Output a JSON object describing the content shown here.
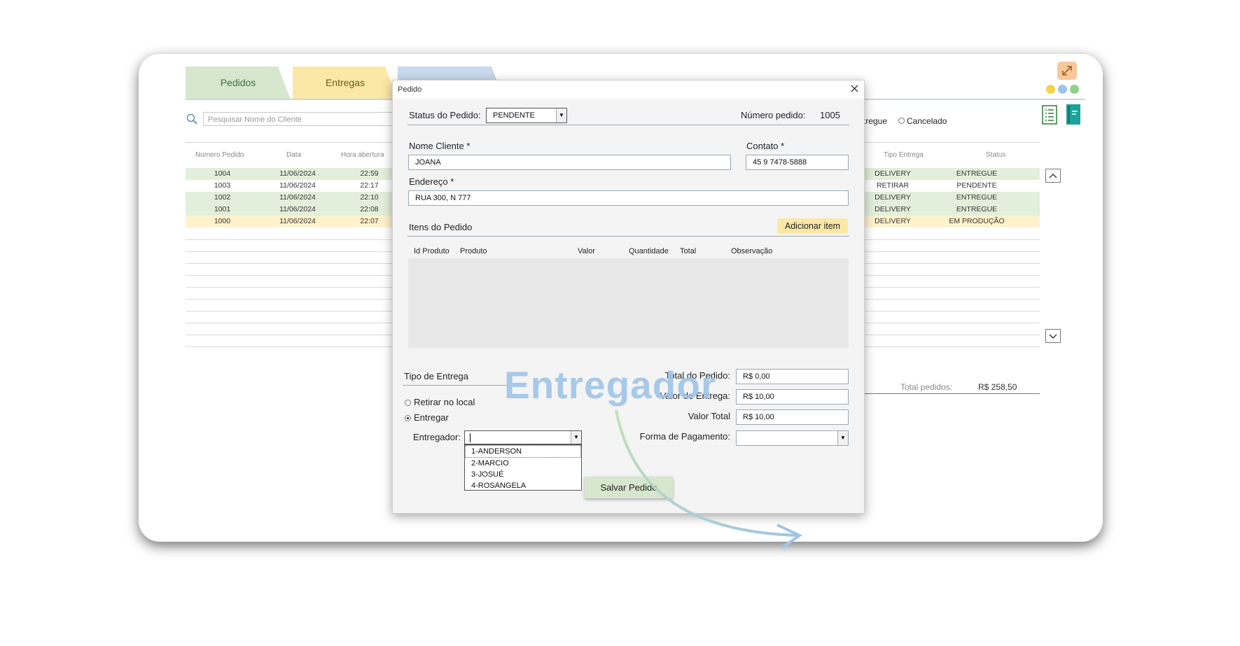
{
  "tabs": [
    {
      "label": "Pedidos"
    },
    {
      "label": "Entregas"
    }
  ],
  "search": {
    "placeholder": "Pesquisar Nome do Cliente"
  },
  "filters": {
    "partial_label": "tregue",
    "cancelado_label": "Cancelado"
  },
  "table": {
    "columns_left": [
      "Numero Pedido",
      "Data",
      "Hora abertura"
    ],
    "columns_right": [
      "Tipo Entrega",
      "Status"
    ],
    "rows": [
      {
        "numero": "1004",
        "data": "11/06/2024",
        "hora": "22:59",
        "tipo": "DELIVERY",
        "status": "ENTREGUE",
        "color": "#e2efda"
      },
      {
        "numero": "1003",
        "data": "11/06/2024",
        "hora": "22:17",
        "tipo": "RETIRAR",
        "status": "PENDENTE",
        "color": "#ffffff"
      },
      {
        "numero": "1002",
        "data": "11/06/2024",
        "hora": "22:10",
        "tipo": "DELIVERY",
        "status": "ENTREGUE",
        "color": "#e2efda"
      },
      {
        "numero": "1001",
        "data": "11/06/2024",
        "hora": "22:08",
        "tipo": "DELIVERY",
        "status": "ENTREGUE",
        "color": "#e2efda"
      },
      {
        "numero": "1000",
        "data": "11/06/2024",
        "hora": "22:07",
        "tipo": "DELIVERY",
        "status": "EM PRODUÇÃO",
        "color": "#fff2cc"
      }
    ],
    "total_label": "Total pedidos:",
    "total_value": "R$ 258,50"
  },
  "colors": {
    "dot1": "#f7d24a",
    "dot2": "#9dc3e6",
    "dot3": "#8fd18f",
    "expand_bg": "#f8c89a",
    "accent_teal": "#1aa39a",
    "overlay_text": "#9fc5e8"
  },
  "dialog": {
    "title": "Pedido",
    "status_label": "Status do Pedido:",
    "status_value": "PENDENTE",
    "numero_label": "Número pedido:",
    "numero_value": "1005",
    "nome_label": "Nome Cliente *",
    "nome_value": "JOANA",
    "contato_label": "Contato *",
    "contato_value": "45 9 7478-5888",
    "endereco_label": "Endereço *",
    "endereco_value": "RUA 300, N 777",
    "itens_label": "Itens do Pedido",
    "add_item_label": "Adicionar item",
    "item_columns": [
      "Id Produto",
      "Produto",
      "Valor",
      "Quantidade",
      "Total",
      "Observação"
    ],
    "tipo_entrega_label": "Tipo de Entrega",
    "retirar_label": "Retirar no local",
    "entregar_label": "Entregar",
    "entregador_label": "Entregador:",
    "entregador_options": [
      "1-ANDERSON",
      "2-MARCIO",
      "3-JOSUÉ",
      "4-ROSANGELA"
    ],
    "total_pedido_label": "Total do Pedido:",
    "total_pedido_value": "R$ 0,00",
    "valor_entrega_label": "Valor de Entrega:",
    "valor_entrega_value": "R$ 10,00",
    "valor_total_label": "Valor Total",
    "valor_total_value": "R$ 10,00",
    "forma_pagamento_label": "Forma de Pagamento:",
    "forma_pagamento_value": "",
    "salvar_label": "Salvar Pedido"
  },
  "overlay": {
    "text": "Entregador"
  }
}
